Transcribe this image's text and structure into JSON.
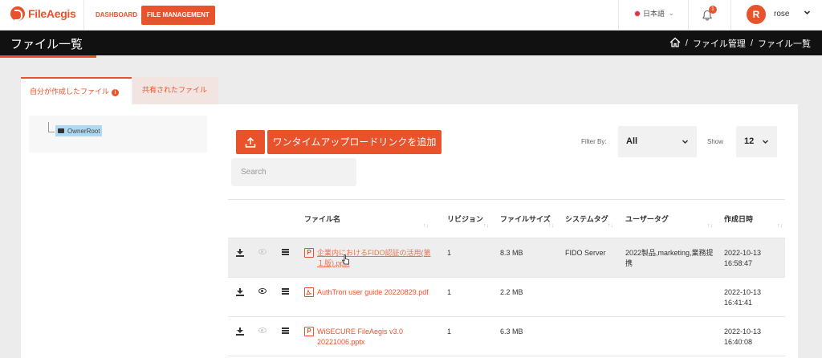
{
  "app": {
    "name": "FileAegis",
    "brand_color": "#e8532b"
  },
  "topnav": {
    "dashboard": "DASHBOARD",
    "file_management": "FILE MANAGEMENT"
  },
  "lang": {
    "label": "日本語",
    "chevron": "⌄"
  },
  "notifications": {
    "count": "1"
  },
  "user": {
    "initial": "R",
    "name": "rose"
  },
  "page": {
    "title": "ファイル一覧"
  },
  "breadcrumb": {
    "items": [
      "ファイル管理",
      "ファイル一覧"
    ],
    "sep": "/"
  },
  "tabs": [
    {
      "label": "自分が作成したファイル",
      "info": "i"
    },
    {
      "label": "共有されたファイル"
    }
  ],
  "tree": {
    "root": "OwnerRoot"
  },
  "toolbar": {
    "onetime_upload_link": "ワンタイムアップロードリンクを追加",
    "filter_label": "Filter By:",
    "filter_value": "All",
    "show_label": "Show",
    "show_value": "12"
  },
  "search": {
    "placeholder": "Search",
    "value": ""
  },
  "table": {
    "headers": {
      "name": "ファイル名",
      "revision": "リビジョン",
      "size": "ファイルサイズ",
      "system_tag": "システムタグ",
      "user_tag": "ユーザータグ",
      "created": "作成日時"
    },
    "sort_glyph": "↑↓",
    "rows": [
      {
        "type": "P",
        "name": "企業内におけるFIDO認証の活用(第１版).pptx",
        "revision": "1",
        "size": "8.3 MB",
        "system_tag": "FIDO Server",
        "user_tag": "2022製品,marketing,業務提携",
        "created": "2022-10-13 16:58:47",
        "preview": false
      },
      {
        "type": "pdf",
        "name": "AuthTron user guide 20220829.pdf",
        "revision": "1",
        "size": "2.2 MB",
        "system_tag": "",
        "user_tag": "",
        "created": "2022-10-13 16:41:41",
        "preview": true
      },
      {
        "type": "P",
        "name": "WiSECURE FileAegis v3.0 20221006.pptx",
        "revision": "1",
        "size": "6.3 MB",
        "system_tag": "",
        "user_tag": "",
        "created": "2022-10-13 16:40:08",
        "preview": false
      }
    ]
  }
}
